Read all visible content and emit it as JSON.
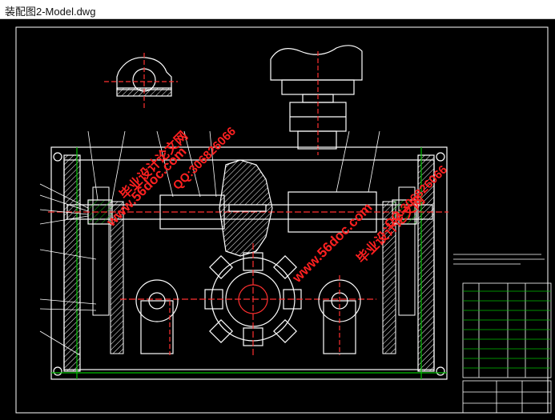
{
  "window": {
    "title": "装配图2-Model.dwg"
  },
  "watermarks": {
    "site_left": "www.56doc.com",
    "qq_left": "QQ:306826066",
    "brand_left": "毕业设计论文网",
    "site_right": "www.56doc.com",
    "qq_right": "QQ:306826066",
    "brand_right": "毕业设计论文网"
  },
  "colors": {
    "background": "#000000",
    "frame": "#ffffff",
    "green": "#00c000",
    "red": "#ff3030",
    "cyan": "#00e0e0",
    "watermark": "#ff2020"
  }
}
